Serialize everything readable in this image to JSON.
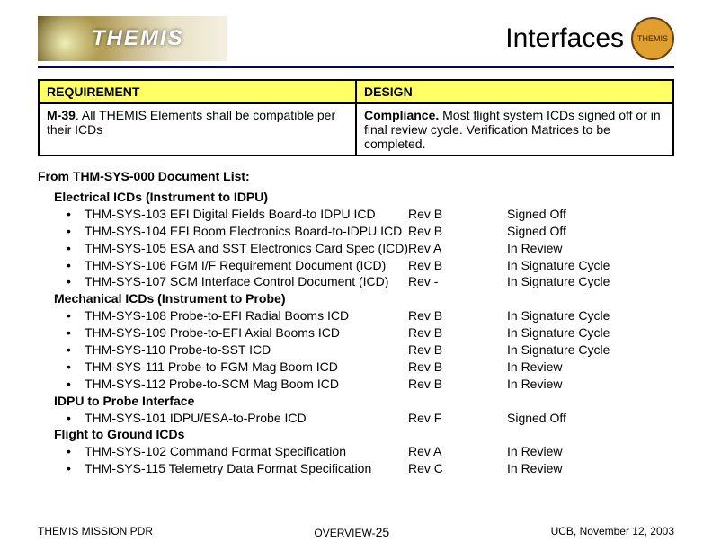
{
  "header": {
    "logo_text": "THEMIS",
    "title": "Interfaces",
    "seal_text": "THEMIS"
  },
  "table": {
    "col1_header": "REQUIREMENT",
    "col2_header": "DESIGN",
    "req_label": "M-39",
    "req_text": ". All THEMIS Elements shall be compatible per their ICDs",
    "design_label": "Compliance.",
    "design_text": " Most flight system ICDs signed off or in final review cycle. Verification Matrices to be completed."
  },
  "section_title": "From THM-SYS-000 Document List:",
  "groups": [
    {
      "heading": "Electrical ICDs (Instrument to IDPU)",
      "items": [
        {
          "doc": "THM-SYS-103 EFI Digital Fields Board-to IDPU ICD",
          "rev": "Rev B",
          "status": "Signed Off"
        },
        {
          "doc": "THM-SYS-104 EFI Boom Electronics Board-to-IDPU ICD",
          "rev": "Rev B",
          "status": "Signed Off"
        },
        {
          "doc": "THM-SYS-105 ESA and SST Electronics Card Spec (ICD)",
          "rev": "Rev A",
          "status": "In Review"
        },
        {
          "doc": "THM-SYS-106 FGM I/F Requirement Document (ICD)",
          "rev": "Rev B",
          "status": "In Signature Cycle"
        },
        {
          "doc": "THM-SYS-107 SCM Interface Control Document (ICD)",
          "rev": "Rev -",
          "status": "In Signature Cycle"
        }
      ]
    },
    {
      "heading": "Mechanical ICDs (Instrument to Probe)",
      "items": [
        {
          "doc": "THM-SYS-108 Probe-to-EFI Radial Booms ICD",
          "rev": "Rev B",
          "status": "In Signature Cycle"
        },
        {
          "doc": "THM-SYS-109 Probe-to-EFI Axial Booms ICD",
          "rev": "Rev B",
          "status": "In Signature Cycle"
        },
        {
          "doc": "THM-SYS-110 Probe-to-SST ICD",
          "rev": "Rev B",
          "status": "In Signature Cycle"
        },
        {
          "doc": "THM-SYS-111 Probe-to-FGM Mag Boom ICD",
          "rev": "Rev B",
          "status": "In Review"
        },
        {
          "doc": "THM-SYS-112 Probe-to-SCM Mag Boom ICD",
          "rev": "Rev B",
          "status": "In Review"
        }
      ]
    },
    {
      "heading": "IDPU to Probe Interface",
      "items": [
        {
          "doc": "THM-SYS-101 IDPU/ESA-to-Probe ICD",
          "rev": "Rev F",
          "status": "Signed Off"
        }
      ]
    },
    {
      "heading": "Flight to Ground ICDs",
      "items": [
        {
          "doc": "THM-SYS-102 Command Format Specification",
          "rev": "Rev A",
          "status": "In Review"
        },
        {
          "doc": "THM-SYS-115 Telemetry Data Format Specification",
          "rev": "Rev C",
          "status": "In Review"
        }
      ]
    }
  ],
  "footer": {
    "left": "THEMIS MISSION PDR",
    "center_prefix": "OVERVIEW-",
    "center_num": "25",
    "right": "UCB, November 12, 2003"
  }
}
